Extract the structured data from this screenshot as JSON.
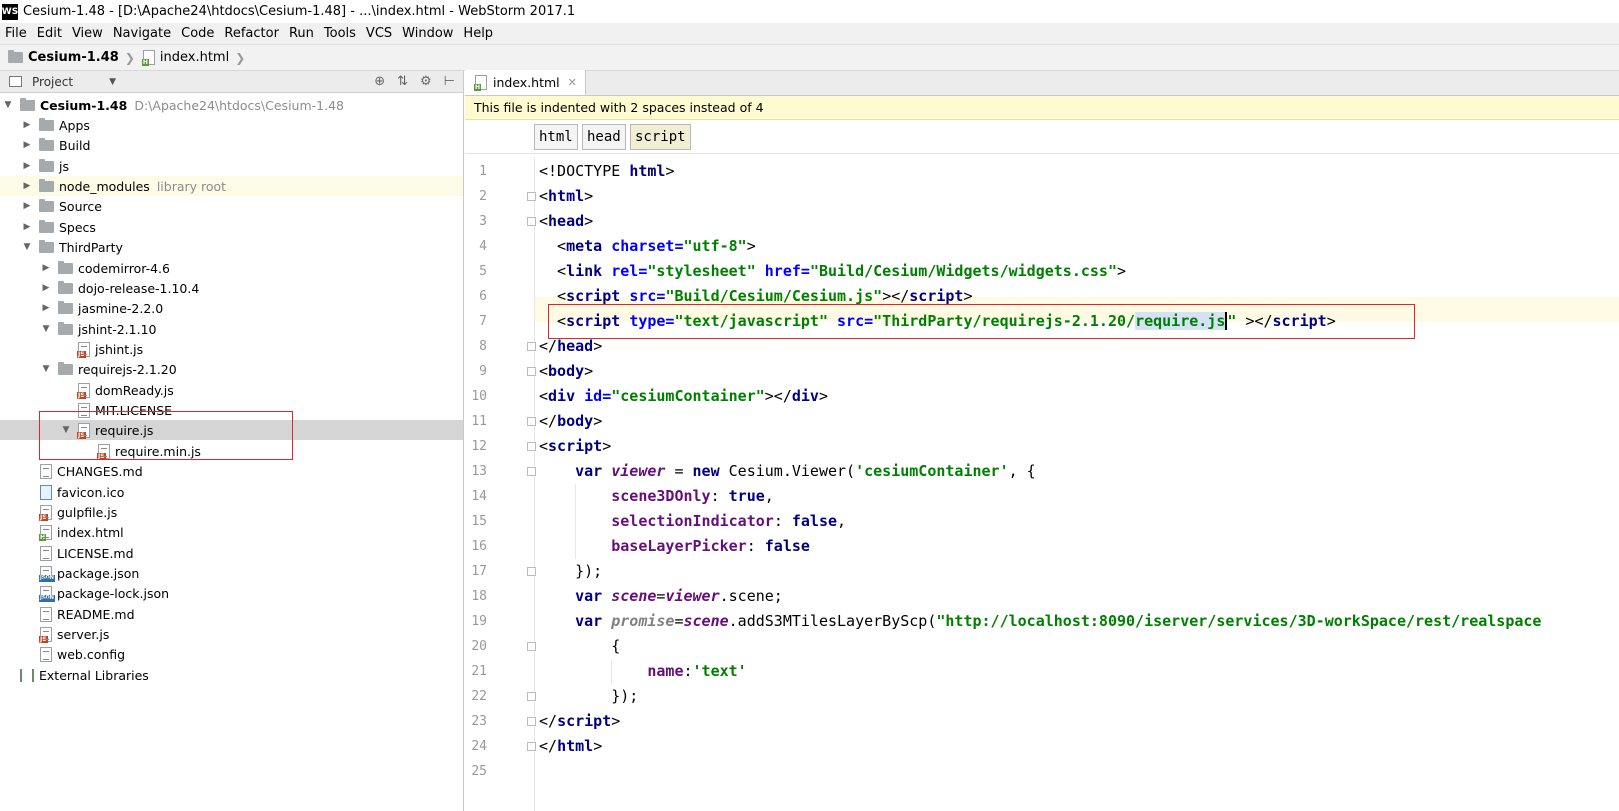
{
  "window": {
    "app_icon": "WS",
    "title": "Cesium-1.48 - [D:\\Apache24\\htdocs\\Cesium-1.48] - ...\\index.html - WebStorm 2017.1"
  },
  "menu": [
    "File",
    "Edit",
    "View",
    "Navigate",
    "Code",
    "Refactor",
    "Run",
    "Tools",
    "VCS",
    "Window",
    "Help"
  ],
  "navbar": {
    "project": "Cesium-1.48",
    "file": "index.html"
  },
  "project_panel": {
    "label": "Project",
    "root": {
      "name": "Cesium-1.48",
      "path": "D:\\Apache24\\htdocs\\Cesium-1.48"
    },
    "items": {
      "apps": "Apps",
      "build": "Build",
      "js": "js",
      "node_modules": "node_modules",
      "node_modules_meta": "library root",
      "source": "Source",
      "specs": "Specs",
      "thirdparty": "ThirdParty",
      "codemirror": "codemirror-4.6",
      "dojo": "dojo-release-1.10.4",
      "jasmine": "jasmine-2.2.0",
      "jshint_dir": "jshint-2.1.10",
      "jshint_js": "jshint.js",
      "requirejs_dir": "requirejs-2.1.20",
      "domready": "domReady.js",
      "mit": "MIT.LICENSE",
      "require_js": "require.js",
      "require_min": "require.min.js",
      "changes": "CHANGES.md",
      "favicon": "favicon.ico",
      "gulpfile": "gulpfile.js",
      "index": "index.html",
      "license": "LICENSE.md",
      "package": "package.json",
      "package_lock": "package-lock.json",
      "readme": "README.md",
      "server": "server.js",
      "webconfig": "web.config",
      "external": "External Libraries"
    }
  },
  "editor": {
    "tab": "index.html",
    "notice": "This file is indented with 2 spaces instead of 4",
    "breadcrumbs": [
      "html",
      "head",
      "script"
    ],
    "line_numbers": [
      "1",
      "2",
      "3",
      "4",
      "5",
      "6",
      "7",
      "8",
      "9",
      "10",
      "11",
      "12",
      "13",
      "14",
      "15",
      "16",
      "17",
      "18",
      "19",
      "20",
      "21",
      "22",
      "23",
      "24",
      "25"
    ],
    "code": {
      "l1a": "<!DOCTYPE ",
      "l1b": "html",
      "l1c": ">",
      "l2a": "<",
      "l2b": "html",
      "l2c": ">",
      "l3a": "<",
      "l3b": "head",
      "l3c": ">",
      "l4a": "  <",
      "l4b": "meta ",
      "l4c": "charset=",
      "l4d": "\"utf-8\"",
      "l4e": ">",
      "l5a": "  <",
      "l5b": "link ",
      "l5c": "rel=",
      "l5d": "\"stylesheet\" ",
      "l5e": "href=",
      "l5f": "\"Build/Cesium/Widgets/widgets.css\"",
      "l5g": ">",
      "l6a": "  <",
      "l6b": "script ",
      "l6c": "src=",
      "l6d": "\"Build/Cesium/Cesium.js\"",
      "l6e": "></",
      "l6f": "script",
      "l6g": ">",
      "l7a": "  <",
      "l7b": "script ",
      "l7c": "type=",
      "l7d": "\"text/javascript\" ",
      "l7e": "src=",
      "l7f": "\"ThirdParty/requirejs-2.1.20/",
      "l7g": "require.js",
      "l7h": "\" ",
      "l7i": "></",
      "l7j": "script",
      "l7k": ">",
      "l8a": "</",
      "l8b": "head",
      "l8c": ">",
      "l9a": "<",
      "l9b": "body",
      "l9c": ">",
      "l10a": "<",
      "l10b": "div ",
      "l10c": "id=",
      "l10d": "\"cesiumContainer\"",
      "l10e": "></",
      "l10f": "div",
      "l10g": ">",
      "l11a": "</",
      "l11b": "body",
      "l11c": ">",
      "l12a": "<",
      "l12b": "script",
      "l12c": ">",
      "l13a": "    var ",
      "l13b": "viewer",
      "l13c": " = ",
      "l13d": "new ",
      "l13e": "Cesium.Viewer(",
      "l13f": "'cesiumContainer'",
      "l13g": ", {",
      "l14a": "        ",
      "l14b": "scene3DOnly",
      "l14c": ": ",
      "l14d": "true",
      "l14e": ",",
      "l15a": "        ",
      "l15b": "selectionIndicator",
      "l15c": ": ",
      "l15d": "false",
      "l15e": ",",
      "l16a": "        ",
      "l16b": "baseLayerPicker",
      "l16c": ": ",
      "l16d": "false",
      "l17a": "    });",
      "l18a": "    var ",
      "l18b": "scene",
      "l18c": "=",
      "l18d": "viewer",
      "l18e": ".scene;",
      "l19a": "    var ",
      "l19b": "promise",
      "l19c": "=",
      "l19d": "scene",
      "l19e": ".addS3MTilesLayerByScp(",
      "l19f": "\"http://localhost:8090/iserver/services/3D-workSpace/rest/realspace",
      "l20a": "        {",
      "l21a": "            ",
      "l21b": "name",
      "l21c": ":",
      "l21d": "'text'",
      "l22a": "        });",
      "l23a": "</",
      "l23b": "script",
      "l23c": ">",
      "l24a": "</",
      "l24b": "html",
      "l24c": ">"
    }
  }
}
